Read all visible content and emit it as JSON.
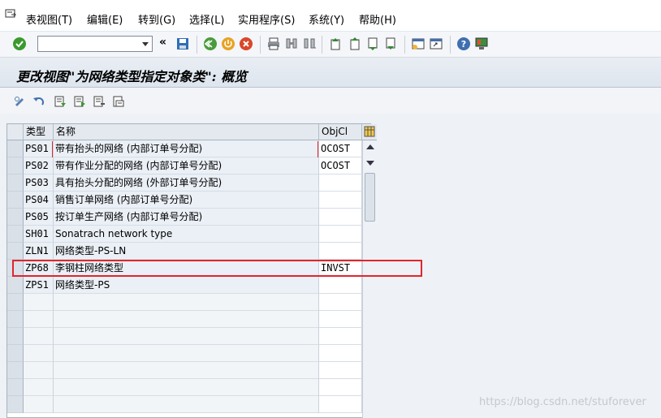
{
  "menubar": {
    "items": [
      "表视图(T)",
      "编辑(E)",
      "转到(G)",
      "选择(L)",
      "实用程序(S)",
      "系统(Y)",
      "帮助(H)"
    ]
  },
  "toolbar": {
    "command_field_value": "",
    "icons": [
      "enter-icon",
      "back-icon",
      "save-icon",
      "green-back-icon",
      "exit-icon",
      "cancel-icon",
      "print-icon",
      "find-icon",
      "find-next-icon",
      "first-page-icon",
      "prev-page-icon",
      "next-page-icon",
      "last-page-icon",
      "new-session-icon",
      "shortcut-icon",
      "help-icon",
      "customize-layout-icon"
    ]
  },
  "title": "更改视图\"为网络类型指定对象类\": 概览",
  "table": {
    "columns": [
      "类型",
      "名称",
      "ObjCl"
    ],
    "rows": [
      {
        "type": "PS01",
        "name": "带有抬头的网络 (内部订单号分配)",
        "objci": "OCOST"
      },
      {
        "type": "PS02",
        "name": "带有作业分配的网络 (内部订单号分配)",
        "objci": "OCOST"
      },
      {
        "type": "PS03",
        "name": "具有抬头分配的网络 (外部订单号分配)",
        "objci": ""
      },
      {
        "type": "PS04",
        "name": "销售订单网络 (内部订单号分配)",
        "objci": ""
      },
      {
        "type": "PS05",
        "name": "按订单生产网络 (内部订单号分配)",
        "objci": ""
      },
      {
        "type": "SH01",
        "name": "Sonatrach network type",
        "objci": ""
      },
      {
        "type": "ZLN1",
        "name": "网络类型-PS-LN",
        "objci": ""
      },
      {
        "type": "ZP68",
        "name": "李钢柱网络类型",
        "objci": "INVST"
      },
      {
        "type": "ZPS1",
        "name": "网络类型-PS",
        "objci": ""
      }
    ]
  },
  "watermark": "https://blog.csdn.net/stuforever"
}
